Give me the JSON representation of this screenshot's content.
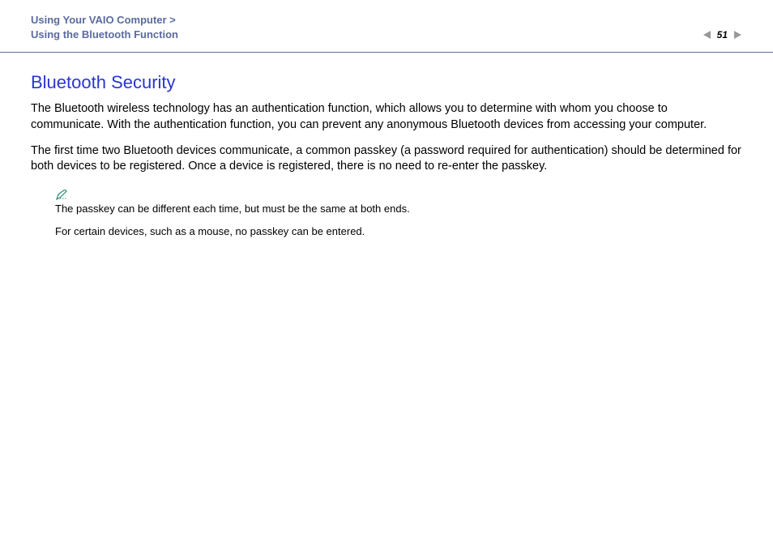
{
  "header": {
    "breadcrumb_line1": "Using Your VAIO Computer >",
    "breadcrumb_line2": "Using the Bluetooth Function",
    "page_number": "51"
  },
  "content": {
    "section_title": "Bluetooth Security",
    "paragraph1": "The Bluetooth wireless technology has an authentication function, which allows you to determine with whom you choose to communicate. With the authentication function, you can prevent any anonymous Bluetooth devices from accessing your computer.",
    "paragraph2": "The first time two Bluetooth devices communicate, a common passkey (a password required for authentication) should be determined for both devices to be registered. Once a device is registered, there is no need to re-enter the passkey.",
    "note1": "The passkey can be different each time, but must be the same at both ends.",
    "note2": "For certain devices, such as a mouse, no passkey can be entered."
  }
}
